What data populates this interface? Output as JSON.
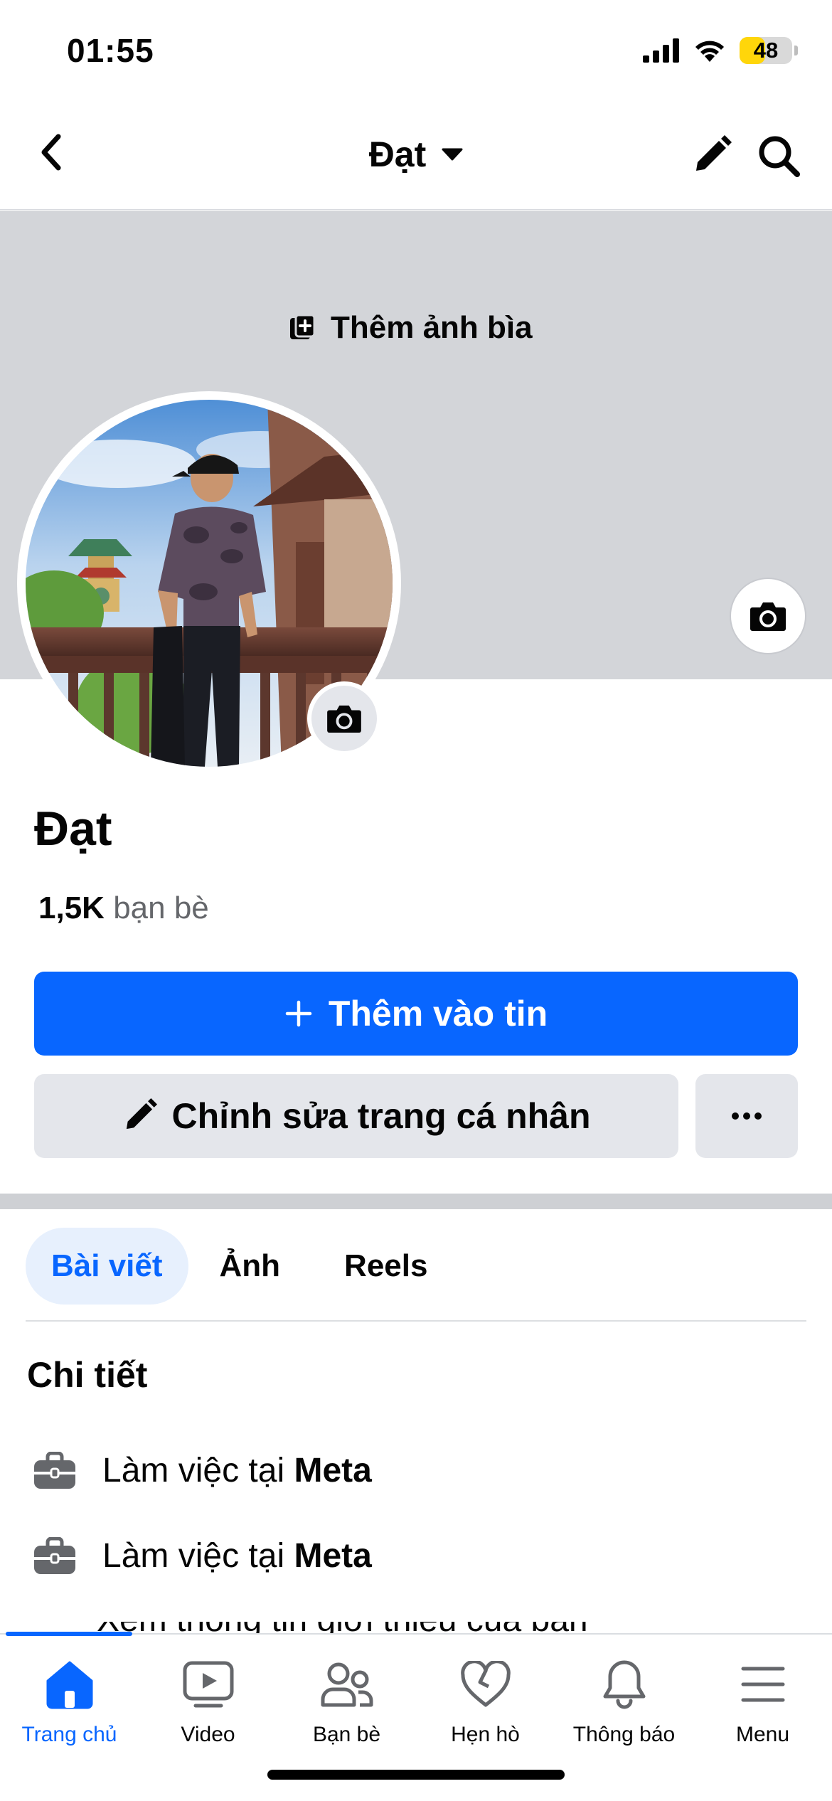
{
  "status_bar": {
    "time": "01:55",
    "battery": "48",
    "battery_level": 0.48
  },
  "header": {
    "title": "Đạt"
  },
  "cover": {
    "add_cover_label": "Thêm ảnh bìa"
  },
  "profile": {
    "name": "Đạt",
    "friends_count": "1,5K",
    "friends_label": "bạn bè",
    "add_story_label": "Thêm vào tin",
    "edit_profile_label": "Chỉnh sửa trang cá nhân",
    "more_label": "•••"
  },
  "tabs": [
    {
      "label": "Bài viết",
      "active": true
    },
    {
      "label": "Ảnh",
      "active": false
    },
    {
      "label": "Reels",
      "active": false
    }
  ],
  "details": {
    "title": "Chi tiết",
    "items": [
      {
        "prefix": "Làm việc tại",
        "place": "Meta"
      },
      {
        "prefix": "Làm việc tại",
        "place": "Meta"
      }
    ],
    "cut_text": "Xem thông tin giới thiệu của bạn"
  },
  "bottom_nav": [
    {
      "label": "Trang chủ",
      "icon": "home-icon",
      "active": true
    },
    {
      "label": "Video",
      "icon": "video-icon",
      "active": false
    },
    {
      "label": "Bạn bè",
      "icon": "friends-icon",
      "active": false
    },
    {
      "label": "Hẹn hò",
      "icon": "dating-heart-icon",
      "active": false
    },
    {
      "label": "Thông báo",
      "icon": "bell-icon",
      "active": false
    },
    {
      "label": "Menu",
      "icon": "menu-icon",
      "active": false
    }
  ],
  "colors": {
    "accent": "#0866ff",
    "cover_bg": "#d3d5d9",
    "button_gray": "#e4e6eb"
  }
}
